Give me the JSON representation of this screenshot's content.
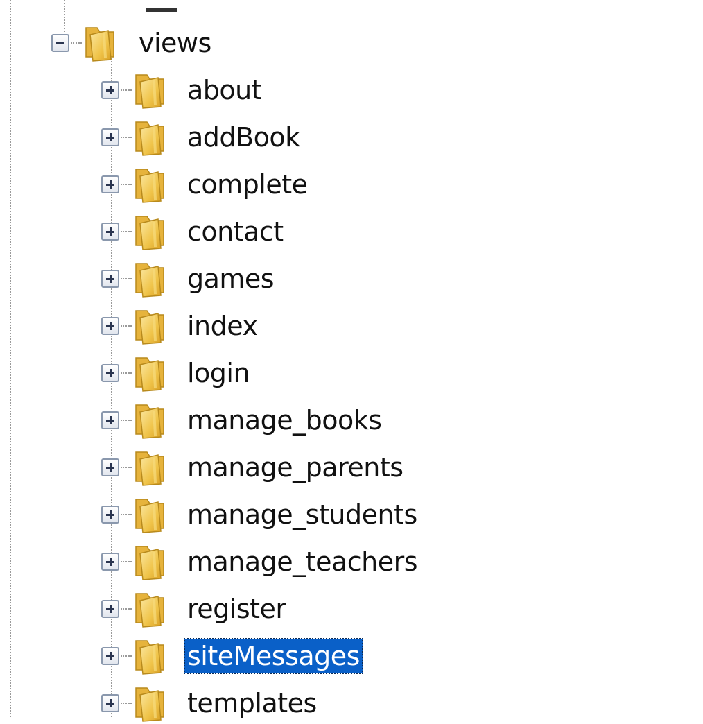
{
  "tree": {
    "root": {
      "label": "views",
      "expanded": true,
      "icon": "folder-icon"
    },
    "children": [
      {
        "label": "about",
        "expanded": false,
        "selected": false
      },
      {
        "label": "addBook",
        "expanded": false,
        "selected": false
      },
      {
        "label": "complete",
        "expanded": false,
        "selected": false
      },
      {
        "label": "contact",
        "expanded": false,
        "selected": false
      },
      {
        "label": "games",
        "expanded": false,
        "selected": false
      },
      {
        "label": "index",
        "expanded": false,
        "selected": false
      },
      {
        "label": "login",
        "expanded": false,
        "selected": false
      },
      {
        "label": "manage_books",
        "expanded": false,
        "selected": false
      },
      {
        "label": "manage_parents",
        "expanded": false,
        "selected": false
      },
      {
        "label": "manage_students",
        "expanded": false,
        "selected": false
      },
      {
        "label": "manage_teachers",
        "expanded": false,
        "selected": false
      },
      {
        "label": "register",
        "expanded": false,
        "selected": false
      },
      {
        "label": "siteMessages",
        "expanded": false,
        "selected": true
      },
      {
        "label": "templates",
        "expanded": false,
        "selected": false
      }
    ]
  },
  "colors": {
    "selection_bg": "#0a60c8",
    "selection_text": "#ffffff",
    "folder": "#f0c44a",
    "text": "#111111",
    "guide": "#9a9a9a"
  }
}
